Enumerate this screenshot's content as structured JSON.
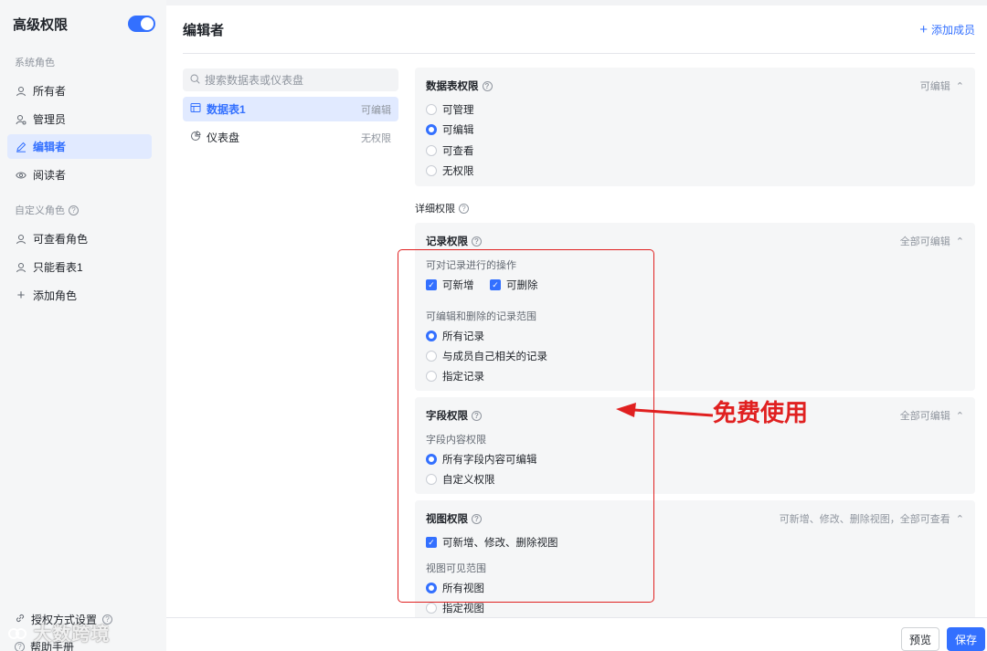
{
  "sidebar": {
    "title": "高级权限",
    "toggle_on": true,
    "system_roles_label": "系统角色",
    "system_roles": [
      {
        "label": "所有者",
        "icon": "user-icon"
      },
      {
        "label": "管理员",
        "icon": "user-gear-icon"
      },
      {
        "label": "编辑者",
        "icon": "pencil-icon",
        "active": true
      },
      {
        "label": "阅读者",
        "icon": "eye-icon"
      }
    ],
    "custom_roles_label": "自定义角色",
    "custom_roles": [
      {
        "label": "可查看角色",
        "icon": "user-icon"
      },
      {
        "label": "只能看表1",
        "icon": "user-icon"
      }
    ],
    "add_role_label": "添加角色",
    "footer": {
      "auth_settings": "授权方式设置",
      "help": "帮助手册"
    }
  },
  "watermark": "大数跨境",
  "main": {
    "title": "编辑者",
    "add_member": "添加成员",
    "search_placeholder": "搜索数据表或仪表盘",
    "tables": [
      {
        "name": "数据表1",
        "perm": "可编辑",
        "icon": "table-icon",
        "active": true
      },
      {
        "name": "仪表盘",
        "perm": "无权限",
        "icon": "dashboard-icon"
      }
    ]
  },
  "table_perm": {
    "title": "数据表权限",
    "summary": "可编辑",
    "options": [
      "可管理",
      "可编辑",
      "可查看",
      "无权限"
    ],
    "selected": 1
  },
  "detail_label": "详细权限",
  "record_perm": {
    "title": "记录权限",
    "summary": "全部可编辑",
    "actions_label": "可对记录进行的操作",
    "actions": [
      "可新增",
      "可删除"
    ],
    "scope_label": "可编辑和删除的记录范围",
    "scope_options": [
      "所有记录",
      "与成员自己相关的记录",
      "指定记录"
    ],
    "scope_selected": 0
  },
  "field_perm": {
    "title": "字段权限",
    "summary": "全部可编辑",
    "content_label": "字段内容权限",
    "options": [
      "所有字段内容可编辑",
      "自定义权限"
    ],
    "selected": 0
  },
  "view_perm": {
    "title": "视图权限",
    "summary": "可新增、修改、删除视图，全部可查看",
    "action": "可新增、修改、删除视图",
    "scope_label": "视图可见范围",
    "options": [
      "所有视图",
      "指定视图"
    ],
    "selected": 0
  },
  "annotation": "免费使用",
  "footer_buttons": {
    "preview": "预览",
    "save": "保存"
  },
  "colors": {
    "accent": "#3370ff",
    "annotation": "#e02020"
  }
}
